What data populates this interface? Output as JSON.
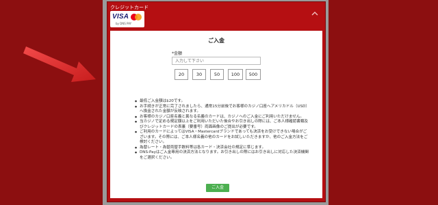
{
  "colors": {
    "panel_red": "#b50f12",
    "submit_green": "#4caf50",
    "arrow_red": "#e52d2d"
  },
  "panel": {
    "title": "クレジットカード",
    "logo": {
      "visa": "VISA",
      "provider": "by DNS PAY"
    },
    "collapse_icon": "chevron-up-icon"
  },
  "form": {
    "heading": "ご入金",
    "amount_label": "*金額",
    "amount_placeholder": "入力して下さい",
    "quick_amounts": [
      "20",
      "30",
      "50",
      "100",
      "500"
    ]
  },
  "notes": [
    "最低ご入金額は$20です。",
    "お手続きが正常に完了されましたら、通常15分前後でお客様のカジノ口座へアメリカドル（USD）へ換金された金額が反映されます。",
    "お客様のカジノ口座名義と異なる名義のカードは、カジノへのご入金にご利用いただけません。",
    "当カジノで定める規定額以上をご利用いただいた後合やお引き出しの際には、ご本人様確認書類及びクレジットカードの表裏（要番号）両面画像のご提出が必要です。",
    "ご利用のカードによってはVISA・Mastercardブランドであっても決済をお受けできない場合がございます。その際には、ご本人様名義の他のカードをお試しいただきますか、他のご入金方法をご検討ください。",
    "為替レート・為替両替手数料等は各カード・決済会社の規定に準じます。",
    "DNS-Payはご入金専用の決済方法となります。お引き出しの際にはお引き出しに対応した決済機関をご選択ください。"
  ],
  "submit_label": "ご入金"
}
